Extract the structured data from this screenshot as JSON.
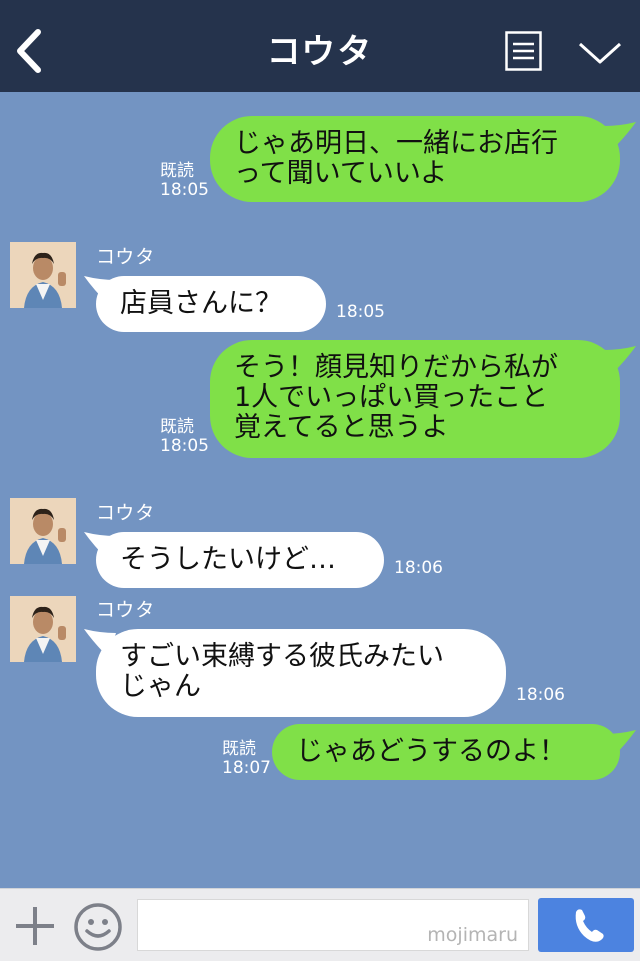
{
  "header": {
    "title": "コウタ",
    "back_icon": "chevron-left-icon",
    "menu_icon": "list-icon",
    "collapse_icon": "chevron-down-icon"
  },
  "messages": [
    {
      "side": "me",
      "lines": [
        "じゃあ明日、一緒にお店行",
        "って聞いていいよ"
      ],
      "read": "既読",
      "time": "18:05"
    },
    {
      "side": "them",
      "sender": "コウタ",
      "lines": [
        "店員さんに？"
      ],
      "time": "18:05"
    },
    {
      "side": "me",
      "lines": [
        "そう！顔見知りだから私が",
        "1人でいっぱい買ったこと",
        "覚えてると思うよ"
      ],
      "read": "既読",
      "time": "18:05"
    },
    {
      "side": "them",
      "sender": "コウタ",
      "lines": [
        "そうしたいけど…"
      ],
      "time": "18:06"
    },
    {
      "side": "them",
      "sender": "コウタ",
      "lines": [
        "すごい束縛する彼氏みたい",
        "じゃん"
      ],
      "time": "18:06"
    },
    {
      "side": "me",
      "lines": [
        "じゃあどうするのよ！"
      ],
      "read": "既読",
      "time": "18:07"
    }
  ],
  "footer": {
    "input_value": "",
    "watermark": "mojimaru",
    "plus_icon": "plus-icon",
    "sticker_icon": "smiley-icon",
    "call_icon": "phone-icon"
  },
  "colors": {
    "header_bg": "#25334c",
    "chat_bg": "#7394c2",
    "my_bubble": "#80e048",
    "their_bubble": "#ffffff",
    "call_button": "#4c83e0"
  }
}
